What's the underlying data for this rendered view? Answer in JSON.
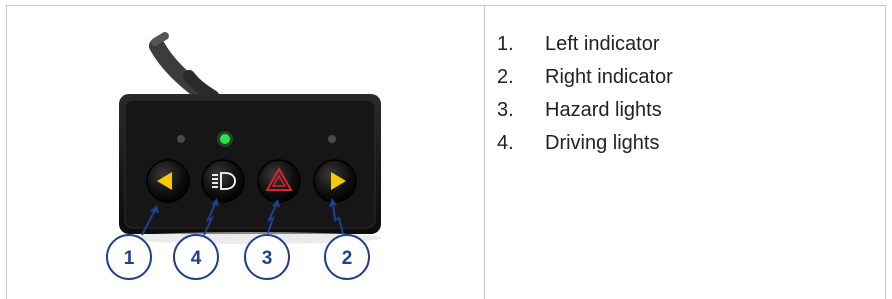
{
  "legend": {
    "items": [
      {
        "number": "1.",
        "label": "Left indicator"
      },
      {
        "number": "2.",
        "label": "Right indicator"
      },
      {
        "number": "3.",
        "label": "Hazard lights"
      },
      {
        "number": "4.",
        "label": "Driving lights"
      }
    ]
  },
  "callouts": {
    "left_indicator": "1",
    "driving_lights": "4",
    "hazard_lights": "3",
    "right_indicator": "2"
  },
  "colors": {
    "callout_blue": "#1f3f8f",
    "indicator_yellow": "#f5c800",
    "hazard_red": "#d8242a",
    "led_green": "#35e04a",
    "panel_black": "#161616",
    "frame_gray": "#c8c8c8"
  },
  "icons": {
    "left_button": "left-arrow-icon",
    "driving_button": "driving-lights-icon",
    "hazard_button": "hazard-triangle-icon",
    "right_button": "right-arrow-icon"
  }
}
